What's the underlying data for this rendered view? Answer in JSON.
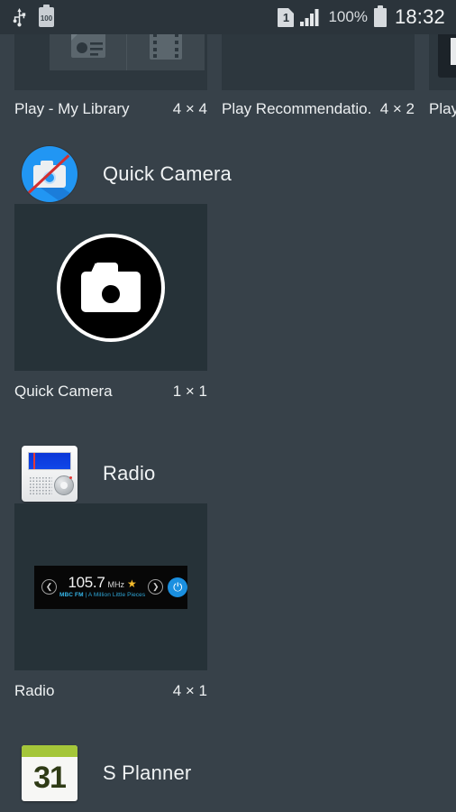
{
  "status_bar": {
    "usb_icon": "usb-icon",
    "battery_label": "100",
    "sim_label": "1",
    "signal_icon": "signal-bars-icon",
    "battery_percent": "100%",
    "battery_icon": "battery-full-icon",
    "clock": "18:32"
  },
  "top_row": [
    {
      "name": "Play - My Library",
      "size": "4 × 4"
    },
    {
      "name": "Play Recommendatio..",
      "size": "4 × 2"
    },
    {
      "name": "Play S",
      "size": ""
    }
  ],
  "groups": [
    {
      "title": "Quick Camera",
      "icon": "quick-camera-app-icon",
      "widgets": [
        {
          "name": "Quick Camera",
          "size": "1 × 1",
          "preview": "camera-circle-preview"
        }
      ]
    },
    {
      "title": "Radio",
      "icon": "radio-app-icon",
      "widgets": [
        {
          "name": "Radio",
          "size": "4 × 1",
          "preview": "radio-player-preview",
          "player": {
            "prev_icon": "chevron-left-icon",
            "next_icon": "chevron-right-icon",
            "frequency": "105.7",
            "unit": "MHz",
            "favorite_icon": "star-icon",
            "station": "MBC FM",
            "separator": "|",
            "track": "A Million Little Pieces",
            "power_icon": "power-icon"
          }
        }
      ]
    },
    {
      "title": "S Planner",
      "icon": "s-planner-app-icon",
      "icon_day": "31",
      "widgets": []
    }
  ]
}
